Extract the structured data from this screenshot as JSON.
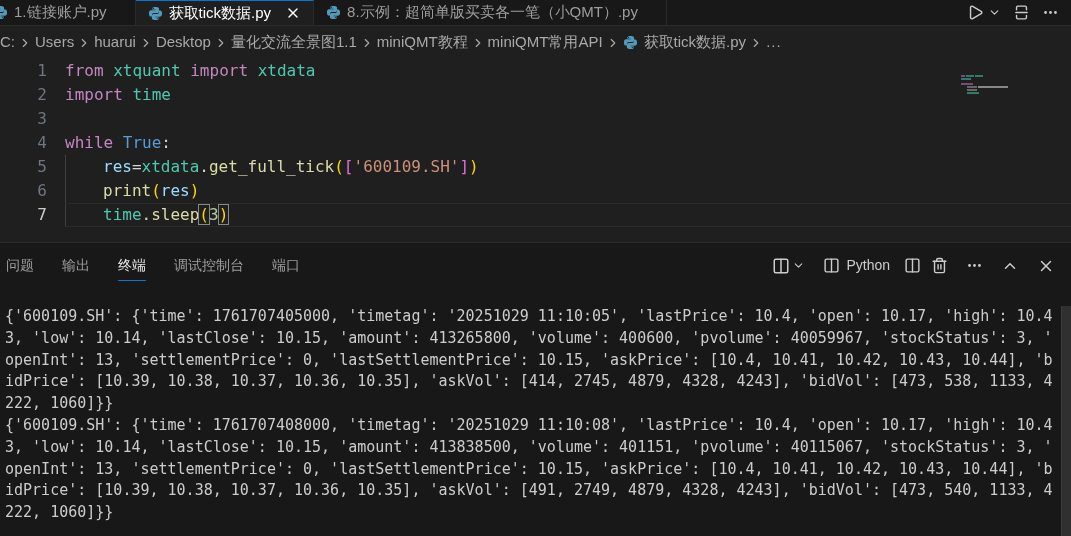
{
  "tabs": [
    {
      "label": "1.链接账户.py",
      "selected": false,
      "closable": false
    },
    {
      "label": "获取tick数据.py",
      "selected": true,
      "closable": true
    },
    {
      "label": "8.示例：超简单版买卖各一笔（小QMT）.py",
      "selected": false,
      "closable": false
    }
  ],
  "breadcrumb": [
    {
      "label": "C:",
      "kind": "folder"
    },
    {
      "label": "Users",
      "kind": "folder"
    },
    {
      "label": "huarui",
      "kind": "folder"
    },
    {
      "label": "Desktop",
      "kind": "folder"
    },
    {
      "label": "量化交流全景图1.1",
      "kind": "folder"
    },
    {
      "label": "miniQMT教程",
      "kind": "folder"
    },
    {
      "label": "miniQMT常用API",
      "kind": "folder"
    },
    {
      "label": "获取tick数据.py",
      "kind": "file"
    },
    {
      "label": "...",
      "kind": "symbol"
    }
  ],
  "code": [
    {
      "number": "1",
      "current": false,
      "indent": false,
      "tokens": [
        {
          "text": "from ",
          "kind": "keyword"
        },
        {
          "text": "xtquant ",
          "kind": "module"
        },
        {
          "text": "import ",
          "kind": "keyword"
        },
        {
          "text": "xtdata",
          "kind": "module"
        }
      ]
    },
    {
      "number": "2",
      "current": false,
      "indent": false,
      "tokens": [
        {
          "text": "import ",
          "kind": "keyword"
        },
        {
          "text": "time",
          "kind": "module"
        }
      ]
    },
    {
      "number": "3",
      "current": false,
      "indent": false
    },
    {
      "number": "4",
      "current": false,
      "indent": false,
      "tokens": [
        {
          "text": "while ",
          "kind": "keyword"
        },
        {
          "text": "True",
          "kind": "constant"
        },
        {
          "text": ":",
          "kind": "plain"
        }
      ]
    },
    {
      "number": "5",
      "current": false,
      "indent": true,
      "tokens": [
        {
          "text": "res",
          "kind": "variable"
        },
        {
          "text": "=",
          "kind": "plain"
        },
        {
          "text": "xtdata",
          "kind": "module"
        },
        {
          "text": ".",
          "kind": "plain"
        },
        {
          "text": "get_full_tick",
          "kind": "function"
        },
        {
          "text": "(",
          "kind": "bracket"
        },
        {
          "text": "[",
          "kind": "bracket2"
        },
        {
          "text": "'600109.SH'",
          "kind": "string"
        },
        {
          "text": "]",
          "kind": "bracket2"
        },
        {
          "text": ")",
          "kind": "bracket"
        }
      ]
    },
    {
      "number": "6",
      "current": false,
      "indent": true,
      "tokens": [
        {
          "text": "print",
          "kind": "function"
        },
        {
          "text": "(",
          "kind": "bracket"
        },
        {
          "text": "res",
          "kind": "variable"
        },
        {
          "text": ")",
          "kind": "bracket"
        }
      ]
    },
    {
      "number": "7",
      "current": true,
      "indent": true,
      "tokens": [
        {
          "text": "time",
          "kind": "module"
        },
        {
          "text": ".",
          "kind": "plain"
        },
        {
          "text": "sleep",
          "kind": "function"
        },
        {
          "text": "(",
          "kind": "bracket-match"
        },
        {
          "text": "3",
          "kind": "number"
        },
        {
          "text": ")",
          "kind": "bracket-match"
        }
      ]
    }
  ],
  "panel_tabs": [
    {
      "label": "问题",
      "selected": false
    },
    {
      "label": "输出",
      "selected": false
    },
    {
      "label": "终端",
      "selected": true
    },
    {
      "label": "调试控制台",
      "selected": false
    },
    {
      "label": "端口",
      "selected": false
    }
  ],
  "terminal_name": "Python",
  "terminal_lines": [
    "{'600109.SH': {'time': 1761707405000, 'timetag': '20251029 11:10:05', 'lastPrice': 10.4, 'open': 10.17, 'high': 10.4",
    "3, 'low': 10.14, 'lastClose': 10.15, 'amount': 413265800, 'volume': 400600, 'pvolume': 40059967, 'stockStatus': 3, '",
    "openInt': 13, 'settlementPrice': 0, 'lastSettlementPrice': 10.15, 'askPrice': [10.4, 10.41, 10.42, 10.43, 10.44], 'b",
    "idPrice': [10.39, 10.38, 10.37, 10.36, 10.35], 'askVol': [414, 2745, 4879, 4328, 4243], 'bidVol': [473, 538, 1133, 4",
    "222, 1060]}}",
    "{'600109.SH': {'time': 1761707408000, 'timetag': '20251029 11:10:08', 'lastPrice': 10.4, 'open': 10.17, 'high': 10.4",
    "3, 'low': 10.14, 'lastClose': 10.15, 'amount': 413838500, 'volume': 401151, 'pvolume': 40115067, 'stockStatus': 3, '",
    "openInt': 13, 'settlementPrice': 0, 'lastSettlementPrice': 10.15, 'askPrice': [10.4, 10.41, 10.42, 10.43, 10.44], 'b",
    "idPrice': [10.39, 10.38, 10.37, 10.36, 10.35], 'askVol': [491, 2749, 4879, 4328, 4243], 'bidVol': [473, 540, 1133, 4",
    "222, 1060]}}"
  ]
}
